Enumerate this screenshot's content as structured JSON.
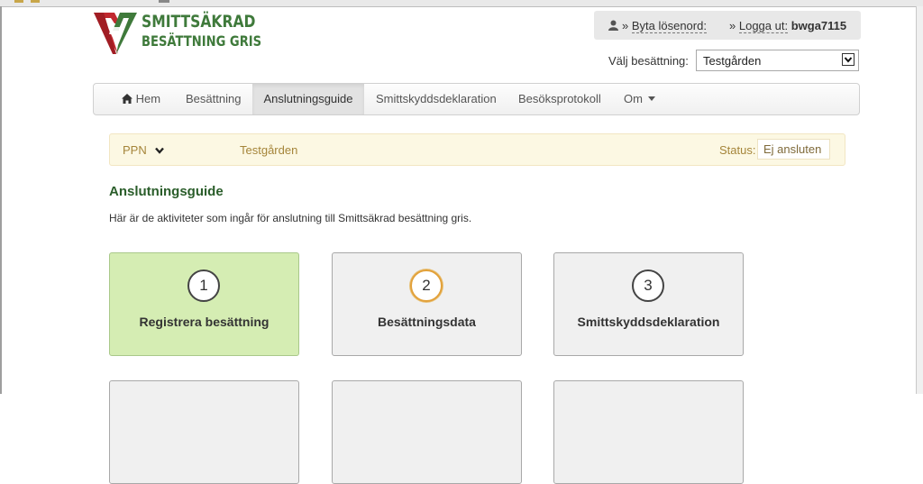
{
  "logo": {
    "line1": "SMITTSÄKRAD",
    "line2": "BESÄTTNING GRIS"
  },
  "user": {
    "change_password": "Byta lösenord:",
    "logout_prefix": "Logga ut:",
    "username": "bwga7115",
    "separator": "»"
  },
  "herd": {
    "label": "Välj besättning:",
    "selected": "Testgården"
  },
  "nav": {
    "home": "Hem",
    "items": [
      "Besättning",
      "Anslutningsguide",
      "Smittskyddsdeklaration",
      "Besöksprotokoll",
      "Om"
    ],
    "active": "Anslutningsguide"
  },
  "alert": {
    "ppn": "PPN",
    "farm": "Testgården",
    "status_label": "Status:",
    "status_value": "Ej ansluten"
  },
  "page": {
    "title": "Anslutningsguide",
    "intro": "Här är de aktiviteter som ingår för anslutning till Smittsäkrad besättning gris."
  },
  "steps": [
    {
      "number": "1",
      "label": "Registrera besättning",
      "state": "done"
    },
    {
      "number": "2",
      "label": "Besättningsdata",
      "state": "current"
    },
    {
      "number": "3",
      "label": "Smittskyddsdeklaration",
      "state": "pending"
    }
  ],
  "colors": {
    "brand_green": "#3f7a3b",
    "brand_red": "#c0282f",
    "done_card": "#d5edb3",
    "alert_bg": "#fcf8e3",
    "current_ring": "#e2a13a"
  },
  "icons": {
    "user": "user-icon",
    "home": "home-icon",
    "caret": "caret-down-icon",
    "chevron": "chevron-down-icon"
  }
}
